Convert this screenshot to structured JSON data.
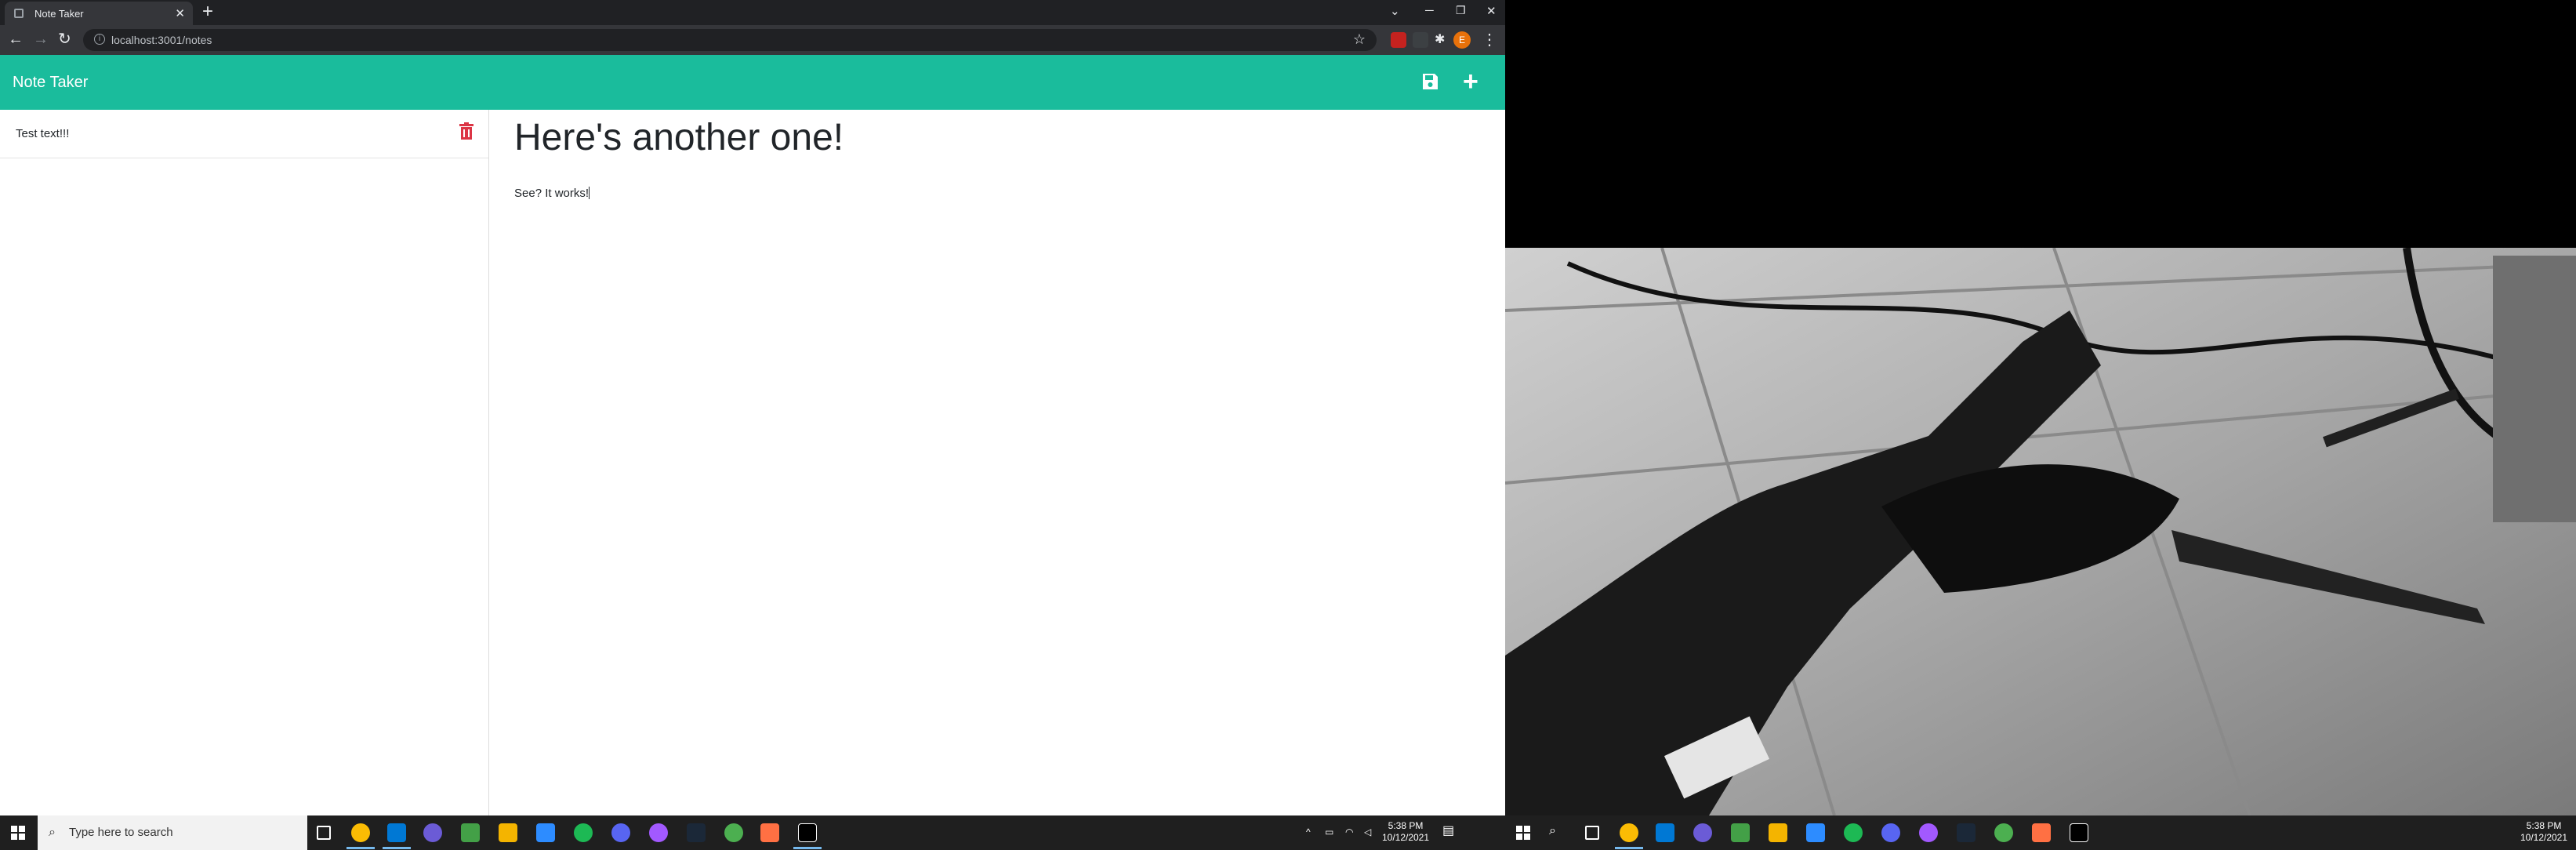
{
  "browser": {
    "tab_title": "Note Taker",
    "url": "localhost:3001/notes",
    "profile_initial": "E"
  },
  "app": {
    "title": "Note Taker",
    "notes": [
      {
        "title": "Test text!!!"
      }
    ],
    "active_note": {
      "title": "Here's another one!",
      "text": "See? It works!"
    },
    "colors": {
      "header": "#1abc9c",
      "delete": "#dc3545"
    }
  },
  "taskbar_left": {
    "search_placeholder": "Type here to search",
    "time": "5:38 PM",
    "date": "10/12/2021"
  },
  "taskbar_right": {
    "time": "5:38 PM",
    "date": "10/12/2021"
  }
}
